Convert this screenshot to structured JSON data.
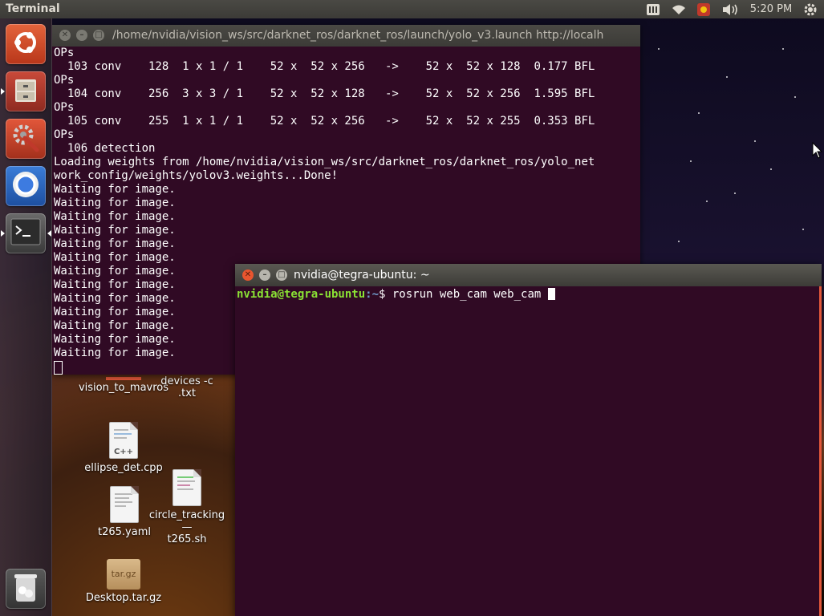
{
  "top_panel": {
    "title": "Terminal",
    "clock": "5:20 PM",
    "tray_icons": [
      "keyboard-icon",
      "wifi-icon",
      "input-method-icon",
      "volume-icon",
      "gear-icon"
    ]
  },
  "launcher": {
    "items": [
      {
        "name": "ubuntu-dash",
        "icon": "ubuntu-logo-icon"
      },
      {
        "name": "files",
        "icon": "file-cabinet-icon"
      },
      {
        "name": "system-settings",
        "icon": "settings-tools-icon"
      },
      {
        "name": "chromium",
        "icon": "chromium-icon"
      },
      {
        "name": "terminal",
        "icon": "terminal-icon"
      },
      {
        "name": "trash",
        "icon": "trash-icon"
      }
    ]
  },
  "window1": {
    "title": "/home/nvidia/vision_ws/src/darknet_ros/darknet_ros/launch/yolo_v3.launch http://localh",
    "lines": [
      "OPs",
      "  103 conv    128  1 x 1 / 1    52 x  52 x 256   ->    52 x  52 x 128  0.177 BFL",
      "OPs",
      "  104 conv    256  3 x 3 / 1    52 x  52 x 128   ->    52 x  52 x 256  1.595 BFL",
      "OPs",
      "  105 conv    255  1 x 1 / 1    52 x  52 x 256   ->    52 x  52 x 255  0.353 BFL",
      "OPs",
      "  106 detection",
      "Loading weights from /home/nvidia/vision_ws/src/darknet_ros/darknet_ros/yolo_net",
      "work_config/weights/yolov3.weights...Done!",
      "Waiting for image.",
      "Waiting for image.",
      "Waiting for image.",
      "Waiting for image.",
      "Waiting for image.",
      "Waiting for image.",
      "Waiting for image.",
      "Waiting for image.",
      "Waiting for image.",
      "Waiting for image.",
      "Waiting for image.",
      "Waiting for image.",
      "Waiting for image."
    ]
  },
  "window2": {
    "title": "nvidia@tegra-ubuntu: ~",
    "prompt_user": "nvidia@tegra-ubuntu",
    "prompt_path": ":~",
    "prompt_symbol": "$ ",
    "command": "rosrun web_cam web_cam "
  },
  "desktop_icons": {
    "vision_to_mavros": "vision_to_mavros",
    "devices_line1": "devices -c",
    "devices_line2": ".txt",
    "ellipse_det": "ellipse_det.cpp",
    "ellipse_badge": "C++",
    "t265_yaml": "t265.yaml",
    "circle_tracking_line1": "circle_tracking—",
    "circle_tracking_line2": "t265.sh",
    "desktop_tar": "Desktop.tar.gz",
    "tar_badge": "tar.gz"
  }
}
